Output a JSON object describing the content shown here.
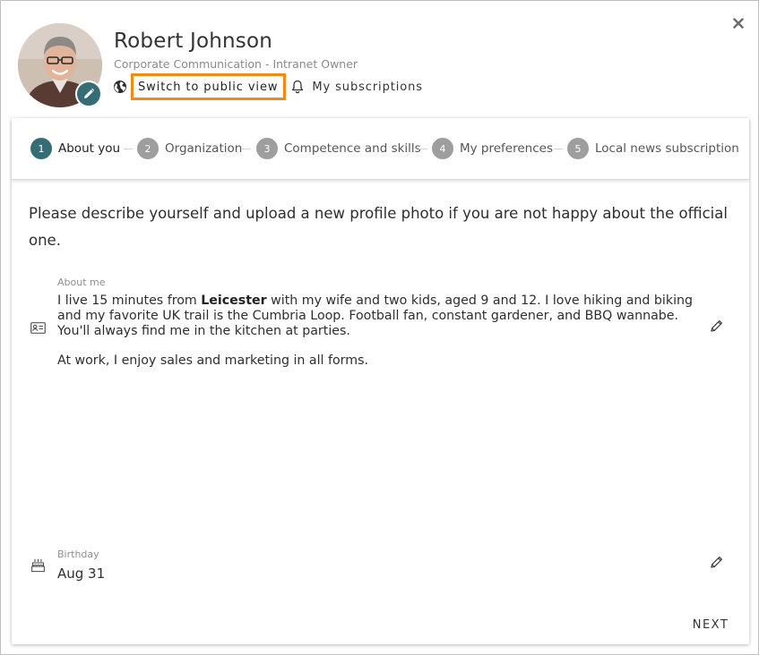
{
  "profile": {
    "name": "Robert Johnson",
    "role": "Corporate Communication - Intranet Owner",
    "public_view_label": "Switch to public view",
    "subscriptions_label": "My subscriptions"
  },
  "steps": [
    {
      "number": "1",
      "label": "About you",
      "active": true
    },
    {
      "number": "2",
      "label": "Organization",
      "active": false
    },
    {
      "number": "3",
      "label": "Competence and skills",
      "active": false
    },
    {
      "number": "4",
      "label": "My preferences",
      "active": false
    },
    {
      "number": "5",
      "label": "Local news subscription",
      "active": false
    }
  ],
  "intro": "Please describe yourself and upload a new profile photo if you are not happy about the official one.",
  "about": {
    "label": "About me",
    "p1_before": "I live 15 minutes from ",
    "p1_bold": "Leicester",
    "p1_after": " with my wife and two kids, aged 9 and 12. I love hiking and biking and my favorite UK trail is the Cumbria Loop. Football fan, constant gardener, and BBQ wannabe. You'll always find me in the kitchen at parties.",
    "p2": "At work, I enjoy sales and marketing in all forms."
  },
  "birthday": {
    "label": "Birthday",
    "value": "Aug 31"
  },
  "actions": {
    "next_label": "NEXT"
  },
  "colors": {
    "accent": "#356d77",
    "highlight": "#f08a14",
    "step_inactive": "#9e9e9e"
  },
  "icons": [
    "close-icon",
    "pencil-icon",
    "globe-icon",
    "bell-icon",
    "contact-card-icon",
    "cake-icon"
  ]
}
